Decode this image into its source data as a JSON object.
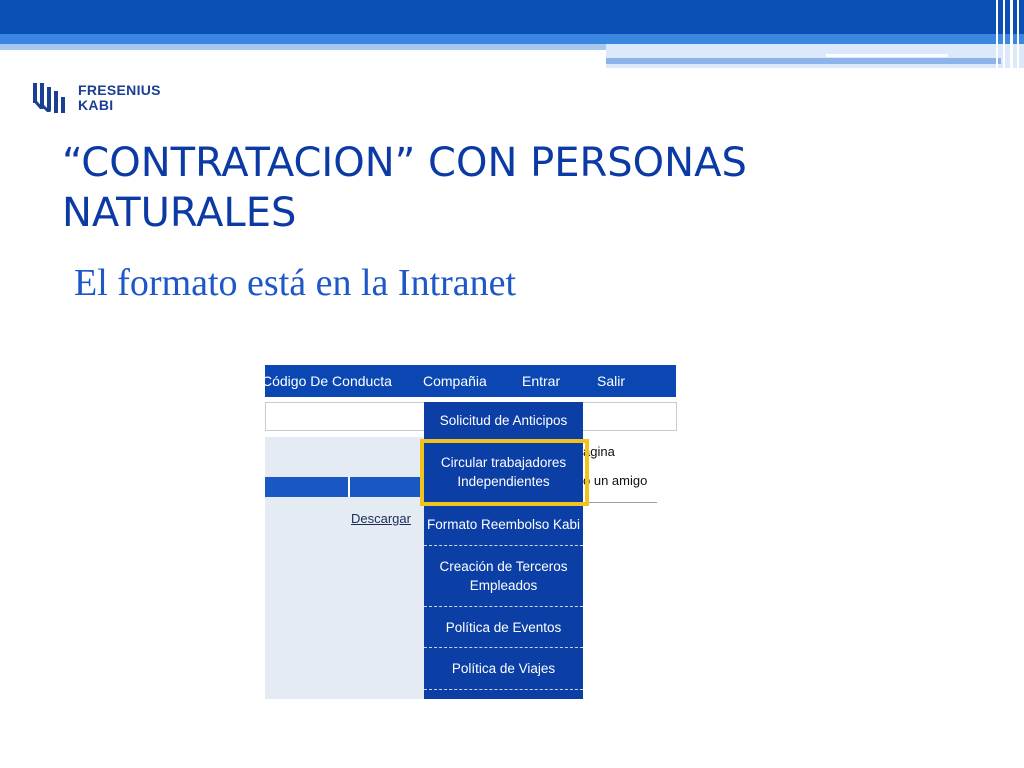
{
  "logo": {
    "line1": "FRESENIUS",
    "line2": "KABI"
  },
  "title": {
    "line1": "“CONTRATACION” CON PERSONAS",
    "line2": "NATURALES"
  },
  "subtitle": "El formato está en la Intranet",
  "intranet": {
    "nav": [
      "Código De Conducta",
      "Compañia",
      "Entrar",
      "Salir"
    ],
    "dropdown": [
      {
        "line1": "Solicitud de Anticipos",
        "line2": ""
      },
      {
        "line1": "Circular trabajadores",
        "line2": "Independientes"
      },
      {
        "line1": "Formato Reembolso Kabi",
        "line2": ""
      },
      {
        "line1": "Creación de Terceros",
        "line2": "Empleados"
      },
      {
        "line1": "Política de Eventos",
        "line2": ""
      },
      {
        "line1": "Política de Viajes",
        "line2": ""
      }
    ],
    "highlighted_item": "Circular trabajadores Independientes",
    "descargar_link": "Descargar",
    "side_text_1": "ágina",
    "side_text_2": "o un amigo"
  },
  "colors": {
    "title": "#0b3aa4",
    "nav_bg": "#0b47b3",
    "dropdown_bg": "#0b3fa6",
    "highlight": "#f2c21d"
  }
}
